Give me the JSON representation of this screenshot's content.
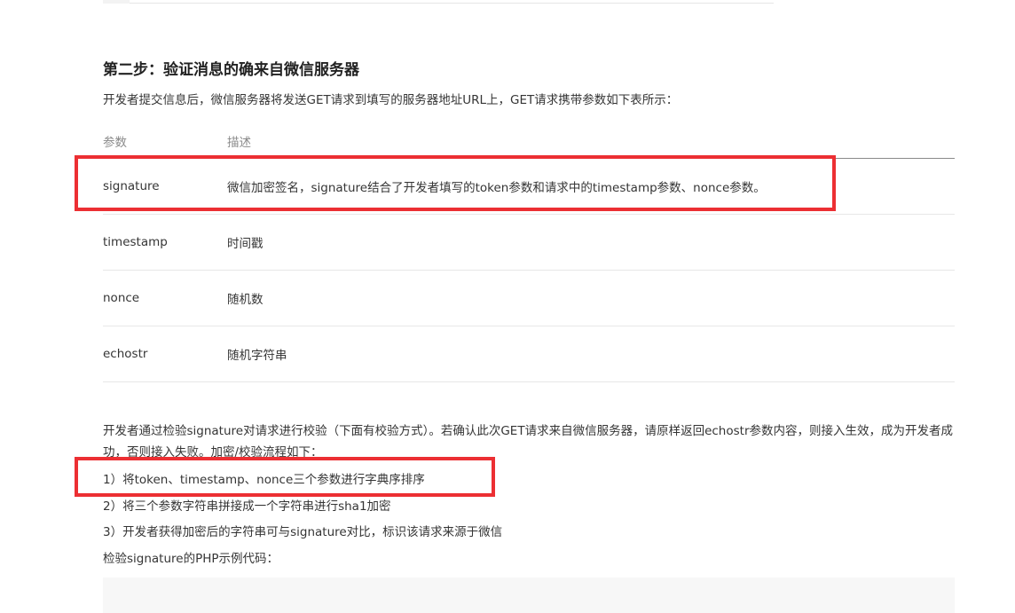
{
  "section": {
    "title": "第二步：验证消息的确来自微信服务器",
    "intro": "开发者提交信息后，微信服务器将发送GET请求到填写的服务器地址URL上，GET请求携带参数如下表所示："
  },
  "table": {
    "headers": [
      "参数",
      "描述"
    ],
    "rows": [
      {
        "param": "signature",
        "desc": "微信加密签名，signature结合了开发者填写的token参数和请求中的timestamp参数、nonce参数。"
      },
      {
        "param": "timestamp",
        "desc": "时间戳"
      },
      {
        "param": "nonce",
        "desc": "随机数"
      },
      {
        "param": "echostr",
        "desc": "随机字符串"
      }
    ]
  },
  "paragraph": "开发者通过检验signature对请求进行校验（下面有校验方式）。若确认此次GET请求来自微信服务器，请原样返回echostr参数内容，则接入生效，成为开发者成功，否则接入失败。加密/校验流程如下：",
  "steps": [
    "1）将token、timestamp、nonce三个参数进行字典序排序",
    "2）将三个参数字符串拼接成一个字符串进行sha1加密",
    "3）开发者获得加密后的字符串可与signature对比，标识该请求来源于微信"
  ],
  "code_caption": "检验signature的PHP示例代码：",
  "colors": {
    "highlight": "#ec2f33",
    "text": "#353535",
    "header_text": "#8a8a8a",
    "code_bg": "#f7f7f7"
  }
}
